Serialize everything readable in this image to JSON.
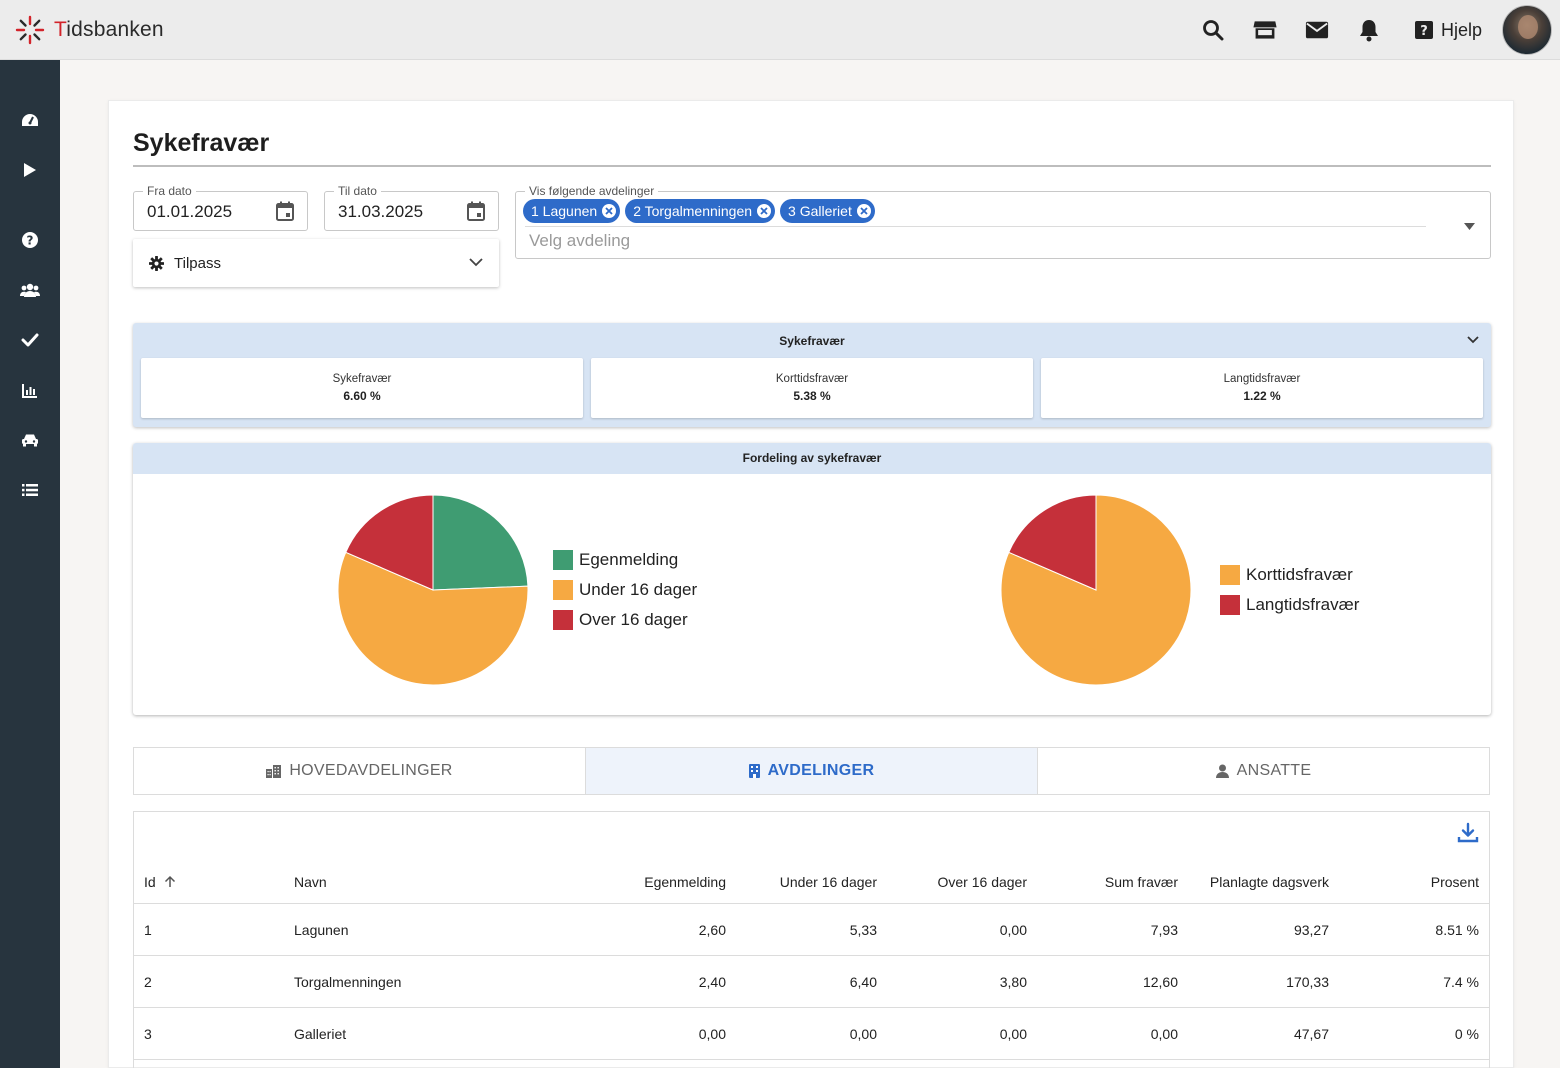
{
  "app": {
    "logo_text_a": "T",
    "logo_text_b": "idsbanken"
  },
  "topbar": {
    "help_label": "Hjelp"
  },
  "page": {
    "title": "Sykefravær"
  },
  "filters": {
    "from_label": "Fra dato",
    "from_value": "01.01.2025",
    "to_label": "Til dato",
    "to_value": "31.03.2025",
    "departments_label": "Vis følgende avdelinger",
    "chips": [
      "1 Lagunen",
      "2 Torgalmenningen",
      "3 Galleriet"
    ],
    "department_placeholder": "Velg avdeling",
    "customize_label": "Tilpass"
  },
  "summary": {
    "title": "Sykefravær",
    "stats": [
      {
        "label": "Sykefravær",
        "value": "6.60 %"
      },
      {
        "label": "Korttidsfravær",
        "value": "5.38 %"
      },
      {
        "label": "Langtidsfravær",
        "value": "1.22 %"
      }
    ]
  },
  "distribution": {
    "title": "Fordeling av sykefravær"
  },
  "chart_data": [
    {
      "type": "pie",
      "title": "",
      "labels": [
        "Egenmelding",
        "Under 16 dager",
        "Over 16 dager"
      ],
      "values": [
        5.0,
        11.73,
        3.8
      ],
      "colors": [
        "#3f9c72",
        "#f6a942",
        "#c5303a"
      ],
      "legend": "right"
    },
    {
      "type": "pie",
      "title": "",
      "labels": [
        "Korttidsfravær",
        "Langtidsfravær"
      ],
      "values": [
        16.73,
        3.8
      ],
      "colors": [
        "#f6a942",
        "#c5303a"
      ],
      "legend": "right"
    }
  ],
  "tabs": [
    {
      "label": "HOVEDAVDELINGER",
      "active": false
    },
    {
      "label": "AVDELINGER",
      "active": true
    },
    {
      "label": "ANSATTE",
      "active": false
    }
  ],
  "table": {
    "columns": [
      "Id",
      "Navn",
      "Egenmelding",
      "Under 16 dager",
      "Over 16 dager",
      "Sum fravær",
      "Planlagte dagsverk",
      "Prosent"
    ],
    "rows": [
      [
        "1",
        "Lagunen",
        "2,60",
        "5,33",
        "0,00",
        "7,93",
        "93,27",
        "8.51 %"
      ],
      [
        "2",
        "Torgalmenningen",
        "2,40",
        "6,40",
        "3,80",
        "12,60",
        "170,33",
        "7.4 %"
      ],
      [
        "3",
        "Galleriet",
        "0,00",
        "0,00",
        "0,00",
        "0,00",
        "47,67",
        "0 %"
      ]
    ]
  },
  "colors": {
    "accent": "#2e6bc9",
    "sidebar": "#27343e",
    "panel_head": "#d7e4f4"
  }
}
